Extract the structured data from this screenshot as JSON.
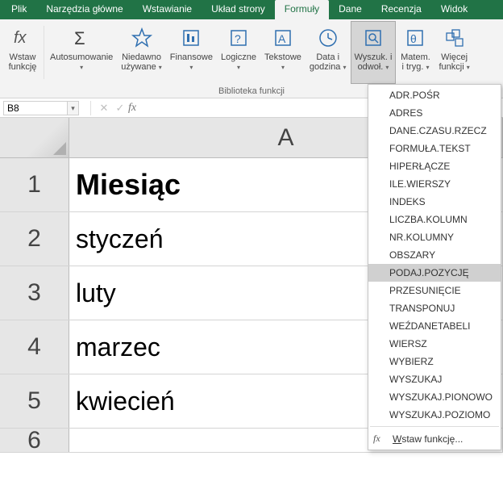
{
  "tabs": {
    "items": [
      {
        "label": "Plik"
      },
      {
        "label": "Narzędzia główne"
      },
      {
        "label": "Wstawianie"
      },
      {
        "label": "Układ strony"
      },
      {
        "label": "Formuły"
      },
      {
        "label": "Dane"
      },
      {
        "label": "Recenzja"
      },
      {
        "label": "Widok"
      }
    ],
    "active_index": 4
  },
  "ribbon": {
    "group_label": "Biblioteka funkcji",
    "buttons": [
      {
        "line1": "Wstaw",
        "line2": "funkcję",
        "has_chev": false
      },
      {
        "line1": "Autosumowanie",
        "line2": "",
        "has_chev": true
      },
      {
        "line1": "Niedawno",
        "line2": "używane",
        "has_chev": true
      },
      {
        "line1": "Finansowe",
        "line2": "",
        "has_chev": true
      },
      {
        "line1": "Logiczne",
        "line2": "",
        "has_chev": true
      },
      {
        "line1": "Tekstowe",
        "line2": "",
        "has_chev": true
      },
      {
        "line1": "Data i",
        "line2": "godzina",
        "has_chev": true
      },
      {
        "line1": "Wyszuk. i",
        "line2": "odwoł.",
        "has_chev": true
      },
      {
        "line1": "Matem.",
        "line2": "i tryg.",
        "has_chev": true
      },
      {
        "line1": "Więcej",
        "line2": "funkcji",
        "has_chev": true
      }
    ],
    "highlight_index": 7
  },
  "formula_bar": {
    "cell_ref": "B8",
    "formula": ""
  },
  "sheet": {
    "col_header": "A",
    "rows": [
      {
        "num": "1",
        "value": "Miesiąc",
        "header": true
      },
      {
        "num": "2",
        "value": "styczeń",
        "header": false
      },
      {
        "num": "3",
        "value": "luty",
        "header": false
      },
      {
        "num": "4",
        "value": "marzec",
        "header": false
      },
      {
        "num": "5",
        "value": "kwiecień",
        "header": false
      },
      {
        "num": "6",
        "value": "",
        "header": false
      }
    ]
  },
  "dropdown": {
    "items": [
      "ADR.POŚR",
      "ADRES",
      "DANE.CZASU.RZECZ",
      "FORMUŁA.TEKST",
      "HIPERŁĄCZE",
      "ILE.WIERSZY",
      "INDEKS",
      "LICZBA.KOLUMN",
      "NR.KOLUMNY",
      "OBSZARY",
      "PODAJ.POZYCJĘ",
      "PRZESUNIĘCIE",
      "TRANSPONUJ",
      "WEŹDANETABELI",
      "WIERSZ",
      "WYBIERZ",
      "WYSZUKAJ",
      "WYSZUKAJ.PIONOWO",
      "WYSZUKAJ.POZIOMO"
    ],
    "selected_index": 10,
    "footer_prefix": "W",
    "footer_rest": "staw funkcję...",
    "footer_fx": "fx"
  }
}
